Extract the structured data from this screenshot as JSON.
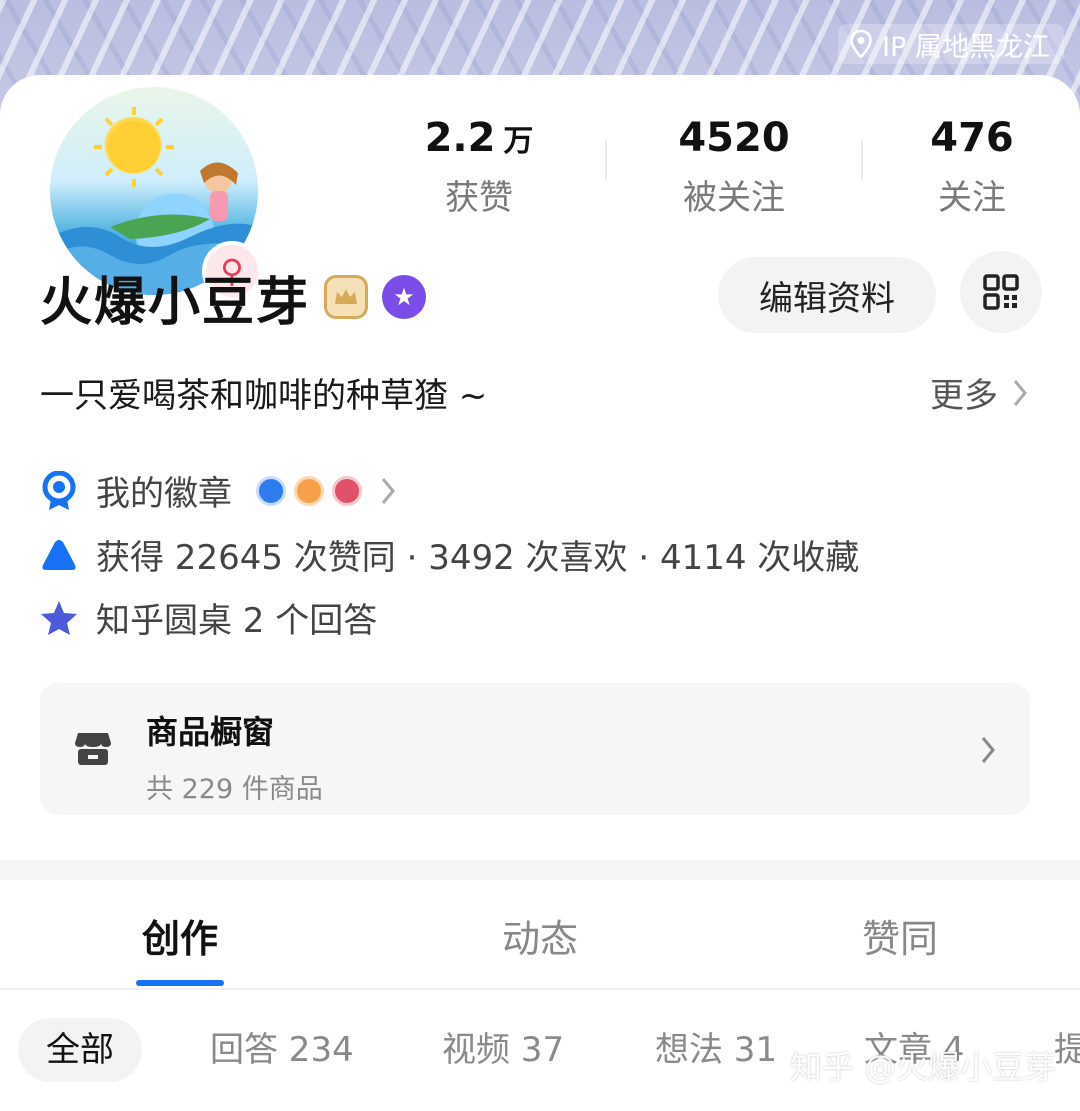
{
  "header": {
    "ip_location": "IP 属地黑龙江"
  },
  "stats": [
    {
      "value": "2.2",
      "unit": "万",
      "label": "获赞"
    },
    {
      "value": "4520",
      "unit": "",
      "label": "被关注"
    },
    {
      "value": "476",
      "unit": "",
      "label": "关注"
    }
  ],
  "profile": {
    "name": "火爆小豆芽",
    "gender_symbol": "♀",
    "edit_label": "编辑资料",
    "bio": "一只爱喝茶和咖啡的种草猹 ~",
    "more_label": "更多",
    "badges_label": "我的徽章",
    "achievements": "获得 22645 次赞同 · 3492 次喜欢 · 4114 次收藏",
    "roundtable": "知乎圆桌 2 个回答"
  },
  "shop": {
    "title": "商品橱窗",
    "subtitle": "共 229 件商品"
  },
  "tabs": [
    {
      "label": "创作",
      "active": true
    },
    {
      "label": "动态",
      "active": false
    },
    {
      "label": "赞同",
      "active": false
    }
  ],
  "subtabs": [
    {
      "label": "全部",
      "active": true
    },
    {
      "label": "回答 234",
      "active": false
    },
    {
      "label": "视频 37",
      "active": false
    },
    {
      "label": "想法 31",
      "active": false
    },
    {
      "label": "文章 4",
      "active": false
    },
    {
      "label": "提",
      "active": false
    }
  ],
  "watermark": "知乎 @火爆小豆芽",
  "colors": {
    "accent": "#1772f6",
    "female": "#ea3a5a",
    "badge_blue": "#1772f6",
    "star": "#4e5bd8"
  }
}
